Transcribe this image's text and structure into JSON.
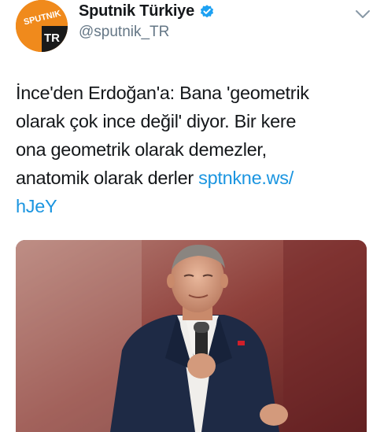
{
  "account": {
    "display_name": "Sputnik Türkiye",
    "handle": "@sputnik_TR",
    "verified": true,
    "avatar": {
      "logo_text": "SPUTNIK",
      "badge_text": "TR",
      "brand_color": "#f08a1c"
    }
  },
  "menu": {
    "icon": "chevron-down-icon"
  },
  "tweet": {
    "lines": [
      "İnce'den Erdoğan'a: Bana 'geometrik",
      "olarak çok ince değil' diyor. Bir kere",
      "ona geometrik olarak demezler,",
      "anatomik olarak derler "
    ],
    "link_part1": "sptnkne.ws/",
    "link_part2": "hJeY"
  },
  "media": {
    "description_icon": "photo-icon"
  },
  "colors": {
    "text": "#14171a",
    "secondary": "#657786",
    "link": "#1b95e0",
    "verified": "#1da1f2"
  }
}
